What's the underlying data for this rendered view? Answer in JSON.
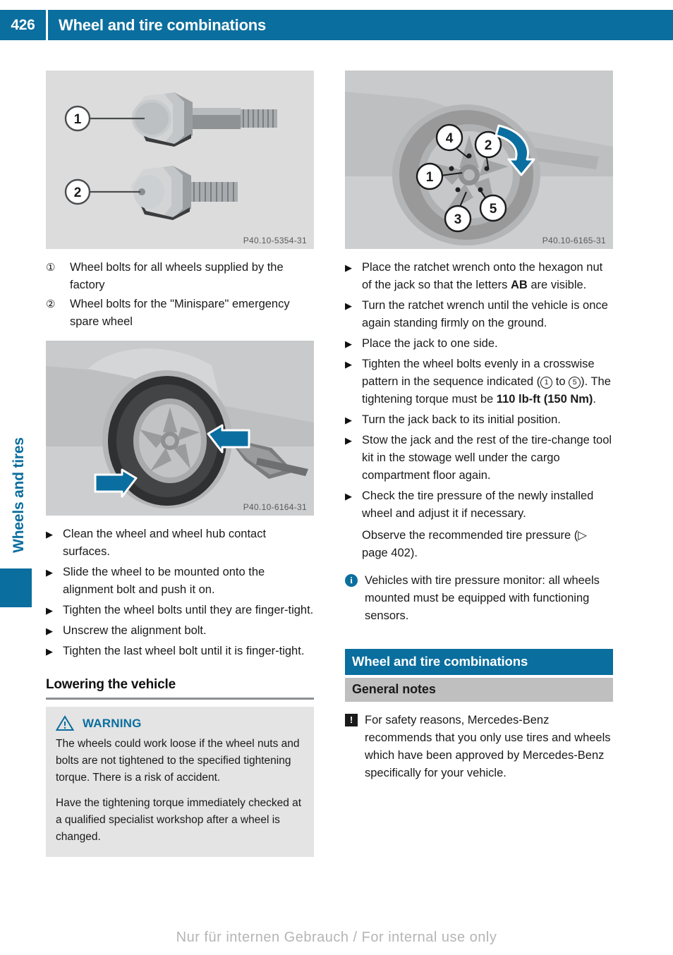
{
  "header": {
    "page_number": "426",
    "title": "Wheel and tire combinations"
  },
  "side_tab": {
    "label": "Wheels and tires"
  },
  "left_column": {
    "figure_bolts": {
      "code": "P40.10-5354-31",
      "callouts": [
        "1",
        "2"
      ]
    },
    "legend": [
      {
        "marker": "①",
        "text": "Wheel bolts for all wheels supplied by the factory"
      },
      {
        "marker": "②",
        "text": "Wheel bolts for the \"Minispare\" emergency spare wheel"
      }
    ],
    "figure_wheel_jack": {
      "code": "P40.10-6164-31"
    },
    "steps": [
      "Clean the wheel and wheel hub contact surfaces.",
      "Slide the wheel to be mounted onto the alignment bolt and push it on.",
      "Tighten the wheel bolts until they are finger-tight.",
      "Unscrew the alignment bolt.",
      "Tighten the last wheel bolt until it is finger-tight."
    ],
    "subheading": "Lowering the vehicle",
    "warning": {
      "icon": "warning-triangle-icon",
      "title": "WARNING",
      "paragraphs": [
        "The wheels could work loose if the wheel nuts and bolts are not tightened to the specified tightening torque. There is a risk of accident.",
        "Have the tightening torque immediately checked at a qualified specialist workshop after a wheel is changed."
      ]
    }
  },
  "right_column": {
    "figure_bolt_sequence": {
      "code": "P40.10-6165-31",
      "callouts": [
        "1",
        "2",
        "3",
        "4",
        "5"
      ]
    },
    "steps": [
      {
        "parts": [
          {
            "t": "Place the ratchet wrench onto the hexagon nut of the jack so that the letters "
          },
          {
            "t": "AB",
            "bold": true
          },
          {
            "t": " are visible."
          }
        ]
      },
      {
        "parts": [
          {
            "t": "Turn the ratchet wrench until the vehicle is once again standing firmly on the ground."
          }
        ]
      },
      {
        "parts": [
          {
            "t": "Place the jack to one side."
          }
        ]
      },
      {
        "parts": [
          {
            "t": "Tighten the wheel bolts evenly in a crosswise pattern in the sequence indicated ("
          },
          {
            "t": "1",
            "circled": true
          },
          {
            "t": " to "
          },
          {
            "t": "5",
            "circled": true
          },
          {
            "t": "). The tightening torque must be "
          },
          {
            "t": "110 lb-ft (150 Nm)",
            "bold": true
          },
          {
            "t": "."
          }
        ]
      },
      {
        "parts": [
          {
            "t": "Turn the jack back to its initial position."
          }
        ]
      },
      {
        "parts": [
          {
            "t": "Stow the jack and the rest of the tire-change tool kit in the stowage well under the cargo compartment floor again."
          }
        ]
      },
      {
        "parts": [
          {
            "t": "Check the tire pressure of the newly installed wheel and adjust it if necessary."
          }
        ]
      }
    ],
    "cross_reference": "Observe the recommended tire pressure (▷ page 402).",
    "info_note": {
      "icon": "info-icon",
      "glyph": "i",
      "text": "Vehicles with tire pressure monitor: all wheels mounted must be equipped with functioning sensors."
    },
    "section_title": "Wheel and tire combinations",
    "subsection_title": "General notes",
    "attention_note": {
      "icon": "attention-icon",
      "glyph": "!",
      "text": "For safety reasons, Mercedes-Benz recommends that you only use tires and wheels which have been approved by Mercedes-Benz specifically for your vehicle."
    }
  },
  "footer": {
    "text": "Nur für internen Gebrauch / For internal use only"
  },
  "colors": {
    "brand_blue": "#0a6e9e",
    "figure_bg": "#dcdcdc",
    "warning_bg": "#e4e4e4",
    "subsection_bg": "#bfbfbf"
  }
}
